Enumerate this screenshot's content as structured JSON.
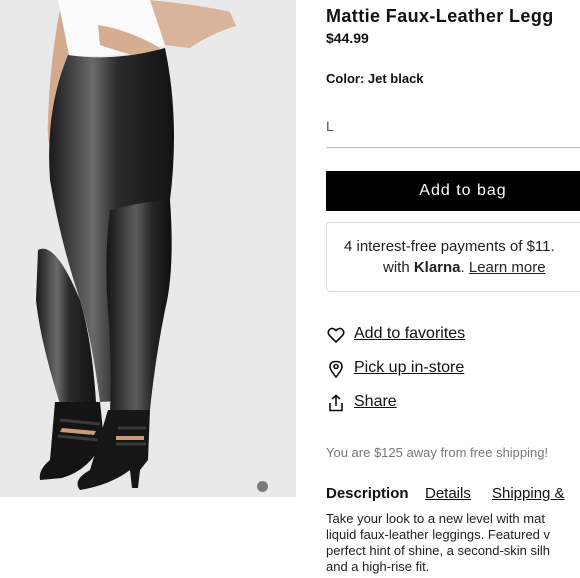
{
  "product": {
    "title": "Mattie Faux-Leather Legg",
    "price": "$44.99",
    "color_label": "Color: Jet black",
    "size_selected": "L"
  },
  "actions": {
    "add_to_bag": "Add to bag",
    "add_to_favorites": "Add to favorites",
    "pick_up": "Pick up in-store",
    "share": "Share"
  },
  "klarna": {
    "line1": "4 interest-free payments of $11.",
    "with": "with ",
    "brand": "Klarna",
    "period": ". ",
    "learn_more": "Learn more"
  },
  "shipping_note": "You are $125 away from free shipping!",
  "tabs": {
    "description": "Description",
    "details": "Details",
    "shipping": "Shipping &"
  },
  "description_lines": [
    "Take your look to a new level with mat",
    "liquid faux-leather leggings. Featured v",
    "perfect hint of shine, a second-skin silh",
    "and a high-rise fit."
  ],
  "icons": {
    "favorite": "heart-icon",
    "pickup": "location-pin-icon",
    "share": "share-icon"
  },
  "colors": {
    "button_bg": "#000000",
    "photo_bg": "#e9e9e9",
    "muted_text": "#777777"
  }
}
